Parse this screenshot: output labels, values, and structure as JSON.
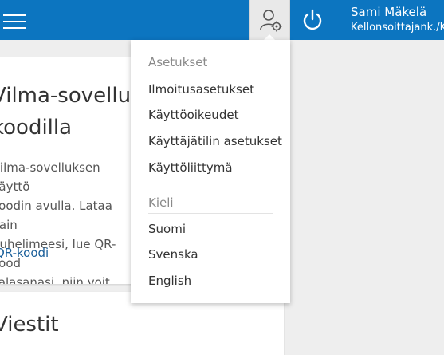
{
  "header": {
    "user_name": "Sami Mäkelä",
    "user_role": "Kellonsoittajank./Kl",
    "colors": {
      "topbar": "#0c75c0",
      "accent": "#1a5f9a"
    }
  },
  "dropdown": {
    "settings_heading": "Asetukset",
    "settings_items": [
      {
        "label": "Ilmoitusasetukset"
      },
      {
        "label": "Käyttöoikeudet"
      },
      {
        "label": "Käyttäjätilin asetukset"
      },
      {
        "label": "Käyttöliittymä"
      }
    ],
    "language_heading": "Kieli",
    "language_items": [
      {
        "label": "Suomi"
      },
      {
        "label": "Svenska"
      },
      {
        "label": "English"
      }
    ]
  },
  "main": {
    "card1": {
      "title_line1": "Vilma-sovellus",
      "title_line2": "koodilla",
      "body_lines": [
        "Vilma-sovelluksen käyttö",
        "koodin avulla. Lataa vain",
        "puhelimeesi, lue QR-kood",
        "salasanasi, niin voit aloit"
      ],
      "link_label": "QR-koodi"
    },
    "card2": {
      "title": "Viestit"
    }
  }
}
